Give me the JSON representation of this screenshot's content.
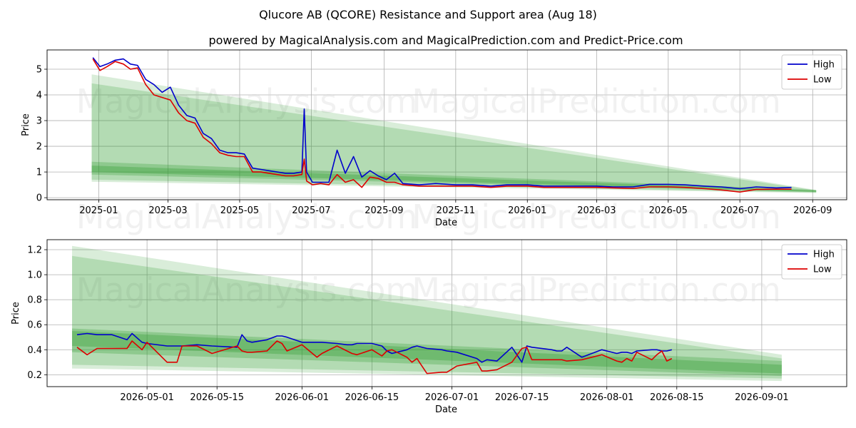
{
  "title": "Qlucore AB (QCORE) Resistance and Support area (Aug 18)",
  "subtitle": "powered by MagicalAnalysis.com and MagicalPrediction.com and Predict-Price.com",
  "watermarks": [
    "MagicalAnalysis.com",
    "MagicalPrediction.com"
  ],
  "colors": {
    "high": "#0000cc",
    "low": "#dd0000",
    "band": "#2e9b2e",
    "grid": "#b0b0b0"
  },
  "chart_data": [
    {
      "type": "line",
      "xlabel": "Date",
      "ylabel": "Price",
      "x_domain": [
        "2024-11-18",
        "2026-09-30"
      ],
      "ylim": [
        -0.08,
        5.75
      ],
      "x_ticks": [
        "2025-01",
        "2025-03",
        "2025-05",
        "2025-07",
        "2025-09",
        "2025-11",
        "2026-01",
        "2026-03",
        "2026-05",
        "2026-07",
        "2026-09"
      ],
      "x_tick_dates": [
        "2025-01-01",
        "2025-03-01",
        "2025-05-01",
        "2025-07-01",
        "2025-09-01",
        "2025-11-01",
        "2026-01-01",
        "2026-03-01",
        "2026-05-01",
        "2026-07-01",
        "2026-09-01"
      ],
      "y_ticks": [
        "0",
        "1",
        "2",
        "3",
        "4",
        "5"
      ],
      "y_tick_values": [
        0,
        1,
        2,
        3,
        4,
        5
      ],
      "legend": {
        "position": "top-right",
        "entries": [
          "High",
          "Low"
        ]
      },
      "grid": true,
      "bands": [
        {
          "x0": "2024-12-26",
          "x1": "2026-09-04",
          "y0": [
            0.62,
            4.8
          ],
          "y1": [
            0.18,
            0.3
          ]
        },
        {
          "x0": "2024-12-26",
          "x1": "2026-09-04",
          "y0": [
            0.7,
            4.45
          ],
          "y1": [
            0.2,
            0.28
          ]
        },
        {
          "x0": "2024-12-26",
          "x1": "2026-09-04",
          "y0": [
            0.9,
            1.4
          ],
          "y1": [
            0.22,
            0.3
          ]
        },
        {
          "x0": "2024-12-26",
          "x1": "2026-09-04",
          "y0": [
            1.0,
            1.25
          ],
          "y1": [
            0.23,
            0.28
          ]
        }
      ],
      "series": [
        {
          "name": "High",
          "x": [
            "2024-12-27",
            "2025-01-02",
            "2025-01-08",
            "2025-01-15",
            "2025-01-22",
            "2025-01-28",
            "2025-02-03",
            "2025-02-10",
            "2025-02-17",
            "2025-02-24",
            "2025-03-03",
            "2025-03-10",
            "2025-03-17",
            "2025-03-24",
            "2025-03-31",
            "2025-04-07",
            "2025-04-14",
            "2025-04-21",
            "2025-04-28",
            "2025-05-05",
            "2025-05-12",
            "2025-05-19",
            "2025-05-26",
            "2025-06-02",
            "2025-06-09",
            "2025-06-16",
            "2025-06-23",
            "2025-06-25",
            "2025-06-27",
            "2025-07-02",
            "2025-07-09",
            "2025-07-16",
            "2025-07-23",
            "2025-07-30",
            "2025-08-06",
            "2025-08-13",
            "2025-08-20",
            "2025-08-27",
            "2025-09-03",
            "2025-09-10",
            "2025-09-17",
            "2025-10-01",
            "2025-10-15",
            "2025-11-01",
            "2025-11-15",
            "2025-12-01",
            "2025-12-15",
            "2026-01-01",
            "2026-01-15",
            "2026-02-01",
            "2026-02-15",
            "2026-03-01",
            "2026-03-15",
            "2026-04-01",
            "2026-04-15",
            "2026-05-01",
            "2026-05-15",
            "2026-06-01",
            "2026-06-15",
            "2026-07-01",
            "2026-07-15",
            "2026-08-01",
            "2026-08-14"
          ],
          "values": [
            5.45,
            5.1,
            5.2,
            5.35,
            5.4,
            5.2,
            5.15,
            4.6,
            4.4,
            4.1,
            4.3,
            3.6,
            3.2,
            3.1,
            2.5,
            2.3,
            1.85,
            1.75,
            1.75,
            1.7,
            1.15,
            1.1,
            1.05,
            1.0,
            0.95,
            0.95,
            1.0,
            3.45,
            1.0,
            0.6,
            0.6,
            0.6,
            1.85,
            0.95,
            1.6,
            0.8,
            1.05,
            0.85,
            0.7,
            0.95,
            0.55,
            0.5,
            0.55,
            0.5,
            0.5,
            0.45,
            0.5,
            0.5,
            0.45,
            0.45,
            0.45,
            0.45,
            0.42,
            0.42,
            0.52,
            0.52,
            0.5,
            0.45,
            0.42,
            0.35,
            0.42,
            0.38,
            0.4
          ]
        },
        {
          "name": "Low",
          "x": [
            "2024-12-27",
            "2025-01-02",
            "2025-01-08",
            "2025-01-15",
            "2025-01-22",
            "2025-01-28",
            "2025-02-03",
            "2025-02-10",
            "2025-02-17",
            "2025-02-24",
            "2025-03-03",
            "2025-03-10",
            "2025-03-17",
            "2025-03-24",
            "2025-03-31",
            "2025-04-07",
            "2025-04-14",
            "2025-04-21",
            "2025-04-28",
            "2025-05-05",
            "2025-05-12",
            "2025-05-19",
            "2025-05-26",
            "2025-06-02",
            "2025-06-09",
            "2025-06-16",
            "2025-06-23",
            "2025-06-25",
            "2025-06-27",
            "2025-07-02",
            "2025-07-09",
            "2025-07-16",
            "2025-07-23",
            "2025-07-30",
            "2025-08-06",
            "2025-08-13",
            "2025-08-20",
            "2025-08-27",
            "2025-09-03",
            "2025-09-10",
            "2025-09-17",
            "2025-10-01",
            "2025-10-15",
            "2025-11-01",
            "2025-11-15",
            "2025-12-01",
            "2025-12-15",
            "2026-01-01",
            "2026-01-15",
            "2026-02-01",
            "2026-02-15",
            "2026-03-01",
            "2026-03-15",
            "2026-04-01",
            "2026-04-15",
            "2026-05-01",
            "2026-05-15",
            "2026-06-01",
            "2026-06-15",
            "2026-07-01",
            "2026-07-15",
            "2026-08-01",
            "2026-08-14"
          ],
          "values": [
            5.4,
            4.95,
            5.1,
            5.3,
            5.2,
            5.0,
            5.05,
            4.4,
            4.0,
            3.9,
            3.8,
            3.3,
            3.0,
            2.9,
            2.35,
            2.1,
            1.75,
            1.65,
            1.6,
            1.6,
            1.0,
            1.0,
            0.95,
            0.9,
            0.85,
            0.85,
            0.9,
            1.5,
            0.65,
            0.5,
            0.55,
            0.5,
            0.9,
            0.6,
            0.7,
            0.4,
            0.8,
            0.75,
            0.6,
            0.6,
            0.5,
            0.45,
            0.45,
            0.45,
            0.45,
            0.4,
            0.45,
            0.45,
            0.4,
            0.4,
            0.4,
            0.4,
            0.38,
            0.36,
            0.42,
            0.42,
            0.4,
            0.35,
            0.3,
            0.22,
            0.32,
            0.33,
            0.33
          ]
        }
      ]
    },
    {
      "type": "line",
      "xlabel": "Date",
      "ylabel": "Price",
      "x_domain": [
        "2026-04-11",
        "2026-09-18"
      ],
      "ylim": [
        0.105,
        1.28
      ],
      "x_ticks": [
        "2026-05-01",
        "2026-05-15",
        "2026-06-01",
        "2026-06-15",
        "2026-07-01",
        "2026-07-15",
        "2026-08-01",
        "2026-08-15",
        "2026-09-01"
      ],
      "y_ticks": [
        "0.2",
        "0.4",
        "0.6",
        "0.8",
        "1.0",
        "1.2"
      ],
      "y_tick_values": [
        0.2,
        0.4,
        0.6,
        0.8,
        1.0,
        1.2
      ],
      "legend": {
        "position": "top-right",
        "entries": [
          "High",
          "Low"
        ]
      },
      "grid": true,
      "bands": [
        {
          "x0": "2026-04-16",
          "x1": "2026-09-05",
          "y0": [
            0.25,
            1.23
          ],
          "y1": [
            0.15,
            0.36
          ]
        },
        {
          "x0": "2026-04-16",
          "x1": "2026-09-05",
          "y0": [
            0.28,
            1.15
          ],
          "y1": [
            0.17,
            0.33
          ]
        },
        {
          "x0": "2026-04-16",
          "x1": "2026-09-05",
          "y0": [
            0.38,
            0.57
          ],
          "y1": [
            0.19,
            0.31
          ]
        },
        {
          "x0": "2026-04-16",
          "x1": "2026-09-05",
          "y0": [
            0.43,
            0.55
          ],
          "y1": [
            0.21,
            0.28
          ]
        }
      ],
      "series": [
        {
          "name": "High",
          "x": [
            "2026-04-17",
            "2026-04-19",
            "2026-04-21",
            "2026-04-24",
            "2026-04-27",
            "2026-04-28",
            "2026-04-30",
            "2026-05-01",
            "2026-05-05",
            "2026-05-07",
            "2026-05-08",
            "2026-05-11",
            "2026-05-14",
            "2026-05-19",
            "2026-05-20",
            "2026-05-21",
            "2026-05-22",
            "2026-05-25",
            "2026-05-27",
            "2026-05-28",
            "2026-05-29",
            "2026-06-01",
            "2026-06-04",
            "2026-06-05",
            "2026-06-08",
            "2026-06-10",
            "2026-06-11",
            "2026-06-12",
            "2026-06-15",
            "2026-06-17",
            "2026-06-18",
            "2026-06-19",
            "2026-06-22",
            "2026-06-23",
            "2026-06-24",
            "2026-06-26",
            "2026-06-29",
            "2026-06-30",
            "2026-07-02",
            "2026-07-06",
            "2026-07-07",
            "2026-07-08",
            "2026-07-10",
            "2026-07-13",
            "2026-07-15",
            "2026-07-16",
            "2026-07-17",
            "2026-07-21",
            "2026-07-22",
            "2026-07-23",
            "2026-07-24",
            "2026-07-27",
            "2026-07-31",
            "2026-08-03",
            "2026-08-04",
            "2026-08-05",
            "2026-08-06",
            "2026-08-07",
            "2026-08-10",
            "2026-08-11",
            "2026-08-12",
            "2026-08-13",
            "2026-08-14"
          ],
          "values": [
            0.52,
            0.53,
            0.52,
            0.52,
            0.48,
            0.53,
            0.46,
            0.45,
            0.43,
            0.43,
            0.43,
            0.44,
            0.43,
            0.42,
            0.52,
            0.47,
            0.46,
            0.48,
            0.51,
            0.51,
            0.5,
            0.46,
            0.46,
            0.46,
            0.45,
            0.44,
            0.44,
            0.45,
            0.45,
            0.43,
            0.39,
            0.37,
            0.4,
            0.42,
            0.43,
            0.41,
            0.4,
            0.39,
            0.38,
            0.33,
            0.3,
            0.32,
            0.31,
            0.42,
            0.3,
            0.43,
            0.42,
            0.4,
            0.39,
            0.39,
            0.42,
            0.34,
            0.4,
            0.37,
            0.38,
            0.38,
            0.37,
            0.39,
            0.4,
            0.4,
            0.39,
            0.39,
            0.4
          ]
        },
        {
          "name": "Low",
          "x": [
            "2026-04-17",
            "2026-04-19",
            "2026-04-21",
            "2026-04-24",
            "2026-04-27",
            "2026-04-28",
            "2026-04-30",
            "2026-05-01",
            "2026-05-05",
            "2026-05-07",
            "2026-05-08",
            "2026-05-11",
            "2026-05-14",
            "2026-05-19",
            "2026-05-20",
            "2026-05-21",
            "2026-05-22",
            "2026-05-25",
            "2026-05-27",
            "2026-05-28",
            "2026-05-29",
            "2026-06-01",
            "2026-06-04",
            "2026-06-05",
            "2026-06-08",
            "2026-06-10",
            "2026-06-11",
            "2026-06-12",
            "2026-06-15",
            "2026-06-17",
            "2026-06-18",
            "2026-06-19",
            "2026-06-22",
            "2026-06-23",
            "2026-06-24",
            "2026-06-26",
            "2026-06-29",
            "2026-06-30",
            "2026-07-02",
            "2026-07-06",
            "2026-07-07",
            "2026-07-08",
            "2026-07-10",
            "2026-07-13",
            "2026-07-15",
            "2026-07-16",
            "2026-07-17",
            "2026-07-21",
            "2026-07-22",
            "2026-07-23",
            "2026-07-24",
            "2026-07-27",
            "2026-07-31",
            "2026-08-03",
            "2026-08-04",
            "2026-08-05",
            "2026-08-06",
            "2026-08-07",
            "2026-08-10",
            "2026-08-11",
            "2026-08-12",
            "2026-08-13",
            "2026-08-14"
          ],
          "values": [
            0.42,
            0.36,
            0.41,
            0.41,
            0.41,
            0.47,
            0.4,
            0.46,
            0.3,
            0.3,
            0.43,
            0.43,
            0.37,
            0.43,
            0.39,
            0.38,
            0.38,
            0.39,
            0.47,
            0.45,
            0.39,
            0.44,
            0.34,
            0.37,
            0.43,
            0.39,
            0.37,
            0.36,
            0.4,
            0.35,
            0.39,
            0.4,
            0.34,
            0.3,
            0.33,
            0.21,
            0.22,
            0.22,
            0.27,
            0.3,
            0.23,
            0.23,
            0.24,
            0.3,
            0.41,
            0.42,
            0.32,
            0.32,
            0.32,
            0.32,
            0.31,
            0.32,
            0.36,
            0.31,
            0.3,
            0.33,
            0.31,
            0.38,
            0.32,
            0.36,
            0.39,
            0.31,
            0.33
          ]
        }
      ]
    }
  ]
}
